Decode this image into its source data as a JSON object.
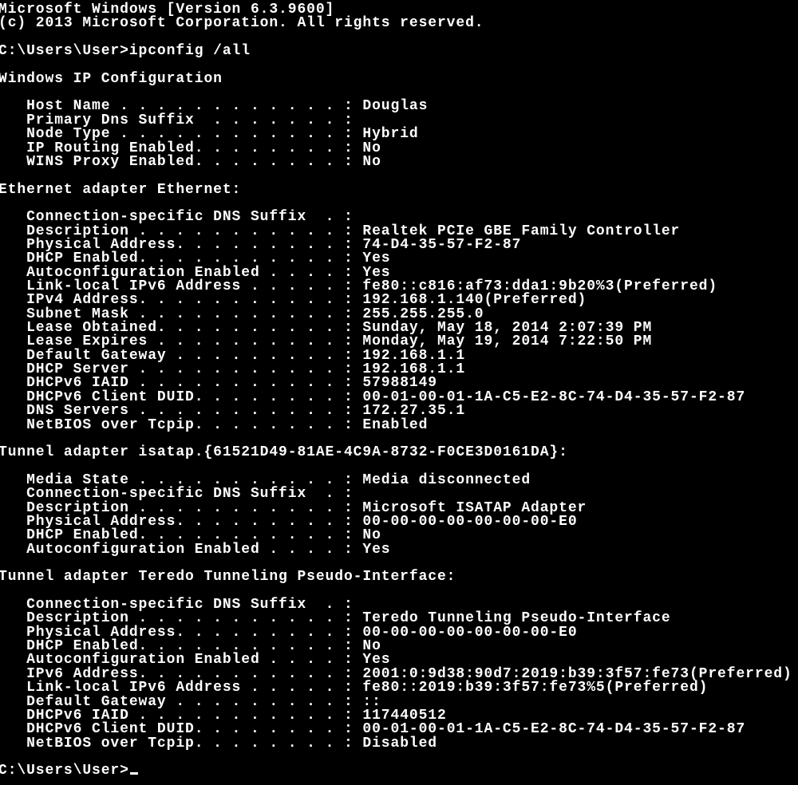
{
  "window": {
    "background": "#000000",
    "foreground": "#ffffff"
  },
  "banner": [
    "Microsoft Windows [Version 6.3.9600]",
    "(c) 2013 Microsoft Corporation. All rights reserved."
  ],
  "command_prompt": "C:\\Users\\User>",
  "command": "ipconfig /all",
  "sections": [
    {
      "title": "Windows IP Configuration",
      "entries": [
        {
          "label": "Host Name . . . . . . . . . . . .",
          "value": "Douglas"
        },
        {
          "label": "Primary Dns Suffix  . . . . . . .",
          "value": ""
        },
        {
          "label": "Node Type . . . . . . . . . . . .",
          "value": "Hybrid"
        },
        {
          "label": "IP Routing Enabled. . . . . . . .",
          "value": "No"
        },
        {
          "label": "WINS Proxy Enabled. . . . . . . .",
          "value": "No"
        }
      ]
    },
    {
      "title": "Ethernet adapter Ethernet:",
      "entries": [
        {
          "label": "Connection-specific DNS Suffix  .",
          "value": ""
        },
        {
          "label": "Description . . . . . . . . . . .",
          "value": "Realtek PCIe GBE Family Controller"
        },
        {
          "label": "Physical Address. . . . . . . . .",
          "value": "74-D4-35-57-F2-87"
        },
        {
          "label": "DHCP Enabled. . . . . . . . . . .",
          "value": "Yes"
        },
        {
          "label": "Autoconfiguration Enabled . . . .",
          "value": "Yes"
        },
        {
          "label": "Link-local IPv6 Address . . . . .",
          "value": "fe80::c816:af73:dda1:9b20%3(Preferred)"
        },
        {
          "label": "IPv4 Address. . . . . . . . . . .",
          "value": "192.168.1.140(Preferred)"
        },
        {
          "label": "Subnet Mask . . . . . . . . . . .",
          "value": "255.255.255.0"
        },
        {
          "label": "Lease Obtained. . . . . . . . . .",
          "value": "Sunday, May 18, 2014 2:07:39 PM"
        },
        {
          "label": "Lease Expires . . . . . . . . . .",
          "value": "Monday, May 19, 2014 7:22:50 PM"
        },
        {
          "label": "Default Gateway . . . . . . . . .",
          "value": "192.168.1.1"
        },
        {
          "label": "DHCP Server . . . . . . . . . . .",
          "value": "192.168.1.1"
        },
        {
          "label": "DHCPv6 IAID . . . . . . . . . . .",
          "value": "57988149"
        },
        {
          "label": "DHCPv6 Client DUID. . . . . . . .",
          "value": "00-01-00-01-1A-C5-E2-8C-74-D4-35-57-F2-87"
        },
        {
          "label": "DNS Servers . . . . . . . . . . .",
          "value": "172.27.35.1"
        },
        {
          "label": "NetBIOS over Tcpip. . . . . . . .",
          "value": "Enabled"
        }
      ]
    },
    {
      "title": "Tunnel adapter isatap.{61521D49-81AE-4C9A-8732-F0CE3D0161DA}:",
      "entries": [
        {
          "label": "Media State . . . . . . . . . . .",
          "value": "Media disconnected"
        },
        {
          "label": "Connection-specific DNS Suffix  .",
          "value": ""
        },
        {
          "label": "Description . . . . . . . . . . .",
          "value": "Microsoft ISATAP Adapter"
        },
        {
          "label": "Physical Address. . . . . . . . .",
          "value": "00-00-00-00-00-00-00-E0"
        },
        {
          "label": "DHCP Enabled. . . . . . . . . . .",
          "value": "No"
        },
        {
          "label": "Autoconfiguration Enabled . . . .",
          "value": "Yes"
        }
      ]
    },
    {
      "title": "Tunnel adapter Teredo Tunneling Pseudo-Interface:",
      "entries": [
        {
          "label": "Connection-specific DNS Suffix  .",
          "value": ""
        },
        {
          "label": "Description . . . . . . . . . . .",
          "value": "Teredo Tunneling Pseudo-Interface"
        },
        {
          "label": "Physical Address. . . . . . . . .",
          "value": "00-00-00-00-00-00-00-E0"
        },
        {
          "label": "DHCP Enabled. . . . . . . . . . .",
          "value": "No"
        },
        {
          "label": "Autoconfiguration Enabled . . . .",
          "value": "Yes"
        },
        {
          "label": "IPv6 Address. . . . . . . . . . .",
          "value": "2001:0:9d38:90d7:2019:b39:3f57:fe73(Preferred)"
        },
        {
          "label": "Link-local IPv6 Address . . . . .",
          "value": "fe80::2019:b39:3f57:fe73%5(Preferred)"
        },
        {
          "label": "Default Gateway . . . . . . . . .",
          "value": "::"
        },
        {
          "label": "DHCPv6 IAID . . . . . . . . . . .",
          "value": "117440512"
        },
        {
          "label": "DHCPv6 Client DUID. . . . . . . .",
          "value": "00-01-00-01-1A-C5-E2-8C-74-D4-35-57-F2-87"
        },
        {
          "label": "NetBIOS over Tcpip. . . . . . . .",
          "value": "Disabled"
        }
      ]
    }
  ]
}
